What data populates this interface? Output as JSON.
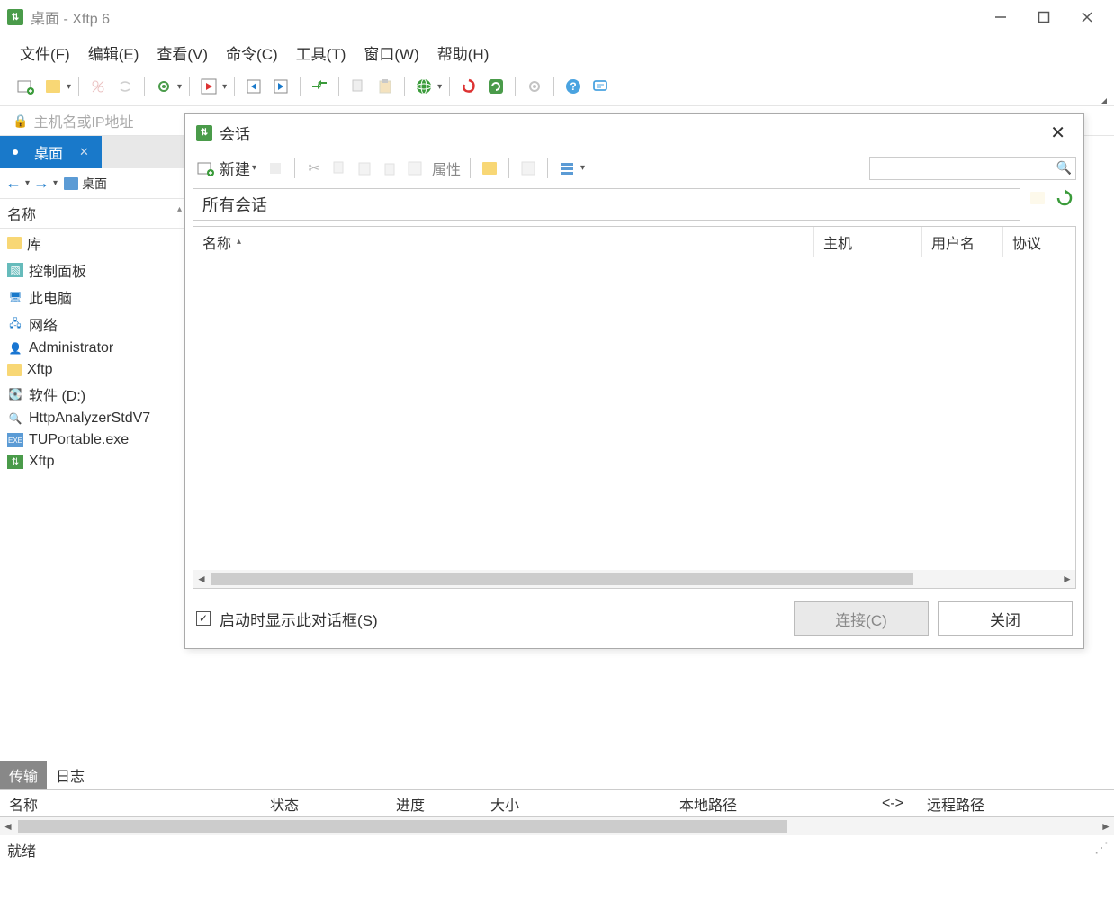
{
  "window": {
    "title": "桌面 - Xftp 6"
  },
  "menu": {
    "file": "文件(F)",
    "edit": "编辑(E)",
    "view": "查看(V)",
    "command": "命令(C)",
    "tools": "工具(T)",
    "window": "窗口(W)",
    "help": "帮助(H)"
  },
  "hostbar": {
    "placeholder": "主机名或IP地址"
  },
  "local": {
    "tab": "桌面",
    "location": "桌面",
    "header": "名称",
    "items": [
      {
        "label": "库",
        "icon": "folder"
      },
      {
        "label": "控制面板",
        "icon": "panel"
      },
      {
        "label": "此电脑",
        "icon": "pc"
      },
      {
        "label": "网络",
        "icon": "net"
      },
      {
        "label": "Administrator",
        "icon": "user"
      },
      {
        "label": "Xftp",
        "icon": "folder"
      },
      {
        "label": "软件 (D:)",
        "icon": "disk"
      },
      {
        "label": "HttpAnalyzerStdV7",
        "icon": "app"
      },
      {
        "label": "TUPortable.exe",
        "icon": "exe"
      },
      {
        "label": "Xftp",
        "icon": "xftp"
      }
    ]
  },
  "dialog": {
    "title": "会话",
    "new_label": "新建",
    "prop_label": "属性",
    "path": "所有会话",
    "columns": {
      "name": "名称",
      "host": "主机",
      "user": "用户名",
      "proto": "协议"
    },
    "show_on_start": "启动时显示此对话框(S)",
    "connect": "连接(C)",
    "close": "关闭"
  },
  "bottom": {
    "tabs": {
      "transfer": "传输",
      "log": "日志"
    },
    "cols": {
      "name": "名称",
      "status": "状态",
      "progress": "进度",
      "size": "大小",
      "local": "本地路径",
      "arrow": "<->",
      "remote": "远程路径"
    }
  },
  "status": {
    "text": "就绪"
  }
}
